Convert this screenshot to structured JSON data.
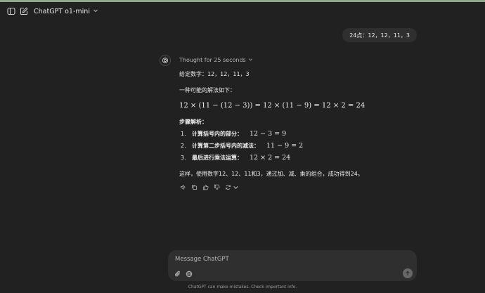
{
  "header": {
    "model_name": "ChatGPT o1-mini"
  },
  "user_message": "24点：12，12，11，3",
  "assistant": {
    "thought_label": "Thought for 25 seconds",
    "given": "给定数字：12，12，11，3",
    "intro": "一种可能的解法如下：",
    "main_equation": "12 × (11 − (12 − 3)) = 12 × (11 − 9) = 12 × 2 = 24",
    "steps_title": "步骤解析：",
    "steps": [
      {
        "num": "1.",
        "label": "计算括号内的部分：",
        "equation": "12 − 3 = 9"
      },
      {
        "num": "2.",
        "label": "计算第二步括号内的减法：",
        "equation": "11 − 9 = 2"
      },
      {
        "num": "3.",
        "label": "最后进行乘法运算：",
        "equation": "12 × 2 = 24"
      }
    ],
    "conclusion": "这样，使用数字12、12、11和3，通过加、减、乘的组合，成功得到24。"
  },
  "composer": {
    "placeholder": "Message ChatGPT"
  },
  "footer": {
    "disclaimer": "ChatGPT can make mistakes. Check important info."
  },
  "icons": {
    "sidebar": "sidebar-toggle-icon",
    "new_chat": "edit-icon",
    "attach": "paperclip-icon",
    "web": "globe-icon",
    "send": "arrow-up-icon"
  },
  "colors": {
    "background": "#212121",
    "bubble": "#2f2f2f",
    "accent_strip": "#8fa88c"
  }
}
